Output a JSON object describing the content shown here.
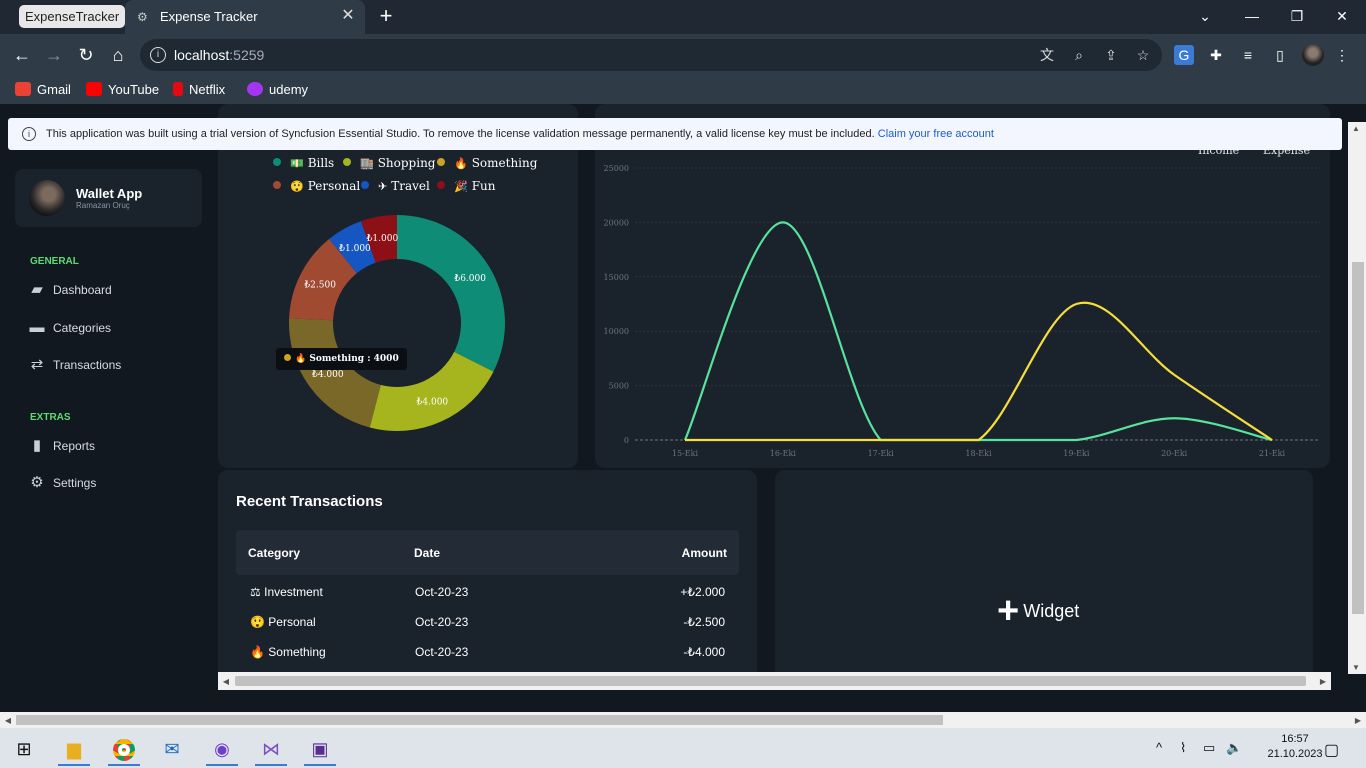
{
  "browser": {
    "profile_chip": "ExpenseTracker",
    "tab_title": "Expense Tracker",
    "url_host": "localhost",
    "url_port": ":5259",
    "bookmarks": [
      {
        "label": "Gmail",
        "color": "#ea4335"
      },
      {
        "label": "YouTube",
        "color": "#ff0000"
      },
      {
        "label": "Netflix",
        "color": "#e50914"
      },
      {
        "label": "udemy",
        "color": "#a435f0"
      }
    ]
  },
  "banner": {
    "text": "This application was built using a trial version of Syncfusion Essential Studio. To remove the license validation message permanently, a valid license key must be included.",
    "link": "Claim your free account"
  },
  "sidebar": {
    "app_name": "Wallet App",
    "user_name": "Ramazan Oruç",
    "general_label": "GENERAL",
    "extras_label": "EXTRAS",
    "general_items": [
      {
        "label": "Dashboard",
        "icon": "wallet-icon"
      },
      {
        "label": "Categories",
        "icon": "folder-icon"
      },
      {
        "label": "Transactions",
        "icon": "swap-icon"
      }
    ],
    "extras_items": [
      {
        "label": "Reports",
        "icon": "bar-chart-icon"
      },
      {
        "label": "Settings",
        "icon": "gear-icon"
      }
    ]
  },
  "pie": {
    "legend": [
      {
        "label": "Bills",
        "emoji": "💵",
        "color": "#0e8c75"
      },
      {
        "label": "Shopping",
        "emoji": "🏬",
        "color": "#a6b41d"
      },
      {
        "label": "Something",
        "emoji": "🔥",
        "color": "#c9a227"
      },
      {
        "label": "Personal",
        "emoji": "😲",
        "color": "#a04a32"
      },
      {
        "label": "Travel",
        "emoji": "✈",
        "color": "#1556c2"
      },
      {
        "label": "Fun",
        "emoji": "🎉",
        "color": "#8c1016"
      }
    ],
    "tooltip": "Something : 4000",
    "tooltip_emoji": "🔥"
  },
  "line_legend": {
    "income": "Income",
    "expense": "Expense"
  },
  "chart_data": [
    {
      "type": "pie",
      "categories": [
        "Bills",
        "Shopping",
        "Something",
        "Personal",
        "Travel",
        "Fun"
      ],
      "values": [
        6000,
        4000,
        4000,
        2500,
        1000,
        1000
      ],
      "labels": [
        "₺6.000",
        "₺4.000",
        "₺4.000",
        "₺2.500",
        "₺1.000",
        "₺1.000"
      ],
      "colors": [
        "#0e8c75",
        "#a6b41d",
        "#c9a227",
        "#a04a32",
        "#1556c2",
        "#8c1016"
      ],
      "donut": true
    },
    {
      "type": "line",
      "x": [
        "15-Eki",
        "16-Eki",
        "17-Eki",
        "18-Eki",
        "19-Eki",
        "20-Eki",
        "21-Eki"
      ],
      "ylim": [
        0,
        25000
      ],
      "yticks": [
        0,
        5000,
        10000,
        15000,
        20000,
        25000
      ],
      "series": [
        {
          "name": "Income",
          "color": "#57e39c",
          "values": [
            0,
            20000,
            0,
            0,
            0,
            2000,
            0
          ]
        },
        {
          "name": "Expense",
          "color": "#f5de3b",
          "values": [
            0,
            0,
            0,
            0,
            12500,
            6000,
            0
          ]
        }
      ],
      "grid": true,
      "legend": "top-right"
    }
  ],
  "transactions": {
    "title": "Recent Transactions",
    "headers": {
      "category": "Category",
      "date": "Date",
      "amount": "Amount"
    },
    "rows": [
      {
        "emoji": "⚖",
        "category": "Investment",
        "date": "Oct-20-23",
        "amount": "+₺2.000"
      },
      {
        "emoji": "😲",
        "category": "Personal",
        "date": "Oct-20-23",
        "amount": "-₺2.500"
      },
      {
        "emoji": "🔥",
        "category": "Something",
        "date": "Oct-20-23",
        "amount": "-₺4.000"
      }
    ]
  },
  "widget": {
    "label": "Widget"
  },
  "taskbar": {
    "time": "16:57",
    "date": "21.10.2023"
  }
}
